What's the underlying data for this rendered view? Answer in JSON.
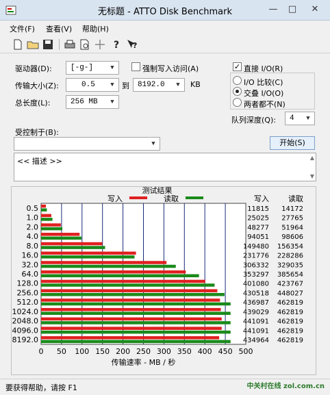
{
  "window": {
    "title": "无标题 - ATTO Disk Benchmark"
  },
  "menu": {
    "items": [
      "文件(F)",
      "查看(V)",
      "帮助(H)"
    ]
  },
  "toolbar": {
    "icons": [
      "new-document-icon",
      "open-folder-icon",
      "save-icon",
      "print-icon",
      "print-preview-icon",
      "move-icon",
      "help-icon",
      "context-help-icon"
    ]
  },
  "settings": {
    "drive_label": "驱动器(D):",
    "drive_value": "[-g-]",
    "force_write_label": "强制写入访问(A)",
    "transfer_label": "传输大小(Z):",
    "transfer_from": "0.5",
    "to_label": "到",
    "transfer_to": "8192.0",
    "kb_label": "KB",
    "total_label": "总长度(L):",
    "total_value": "256 MB",
    "direct_io_label": "直接 I/O(R)",
    "io_compare_label": "I/O 比较(C)",
    "overlapped_io_label": "交叠 I/O(O)",
    "neither_label": "两者都不(N)",
    "queue_label": "队列深度(Q):",
    "queue_value": "4",
    "controlled_by_label": "受控制于(B):",
    "controlled_by_value": "",
    "start_label": "开始(S)",
    "description": "<< 描述 >>"
  },
  "chart_data": {
    "type": "bar",
    "title": "测试结果",
    "legend": [
      {
        "name": "写入",
        "color": "#e02020"
      },
      {
        "name": "读取",
        "color": "#1a8a1a"
      }
    ],
    "categories": [
      "0.5",
      "1.0",
      "2.0",
      "4.0",
      "8.0",
      "16.0",
      "32.0",
      "64.0",
      "128.0",
      "256.0",
      "512.0",
      "1024.0",
      "2048.0",
      "4096.0",
      "8192.0"
    ],
    "series": [
      {
        "name": "写入",
        "color": "#e02020",
        "values": [
          11815,
          25025,
          48277,
          94051,
          149480,
          231776,
          306332,
          353297,
          401080,
          430518,
          436987,
          439029,
          441091,
          441091,
          434964
        ]
      },
      {
        "name": "读取",
        "color": "#1a8a1a",
        "values": [
          14172,
          27765,
          51964,
          98606,
          156354,
          228286,
          329035,
          385654,
          423767,
          448027,
          462819,
          462819,
          462819,
          462819,
          462819
        ]
      }
    ],
    "table_headers": [
      "写入",
      "读取"
    ],
    "xlabel": "传输速率 - MB / 秒",
    "xlim": [
      0,
      500
    ],
    "xticks": [
      0,
      50,
      100,
      150,
      200,
      250,
      300,
      350,
      400,
      450,
      500
    ],
    "grid": true
  },
  "status": {
    "text": "要获得帮助，请按 F1",
    "watermark": "中关村在线 zol.com.cn"
  }
}
